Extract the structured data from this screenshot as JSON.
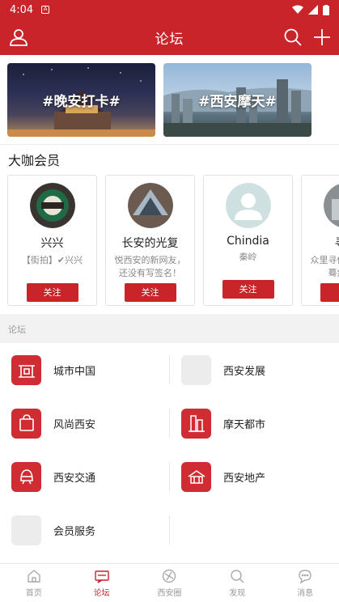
{
  "status_bar": {
    "time": "4:04"
  },
  "header": {
    "title": "论坛"
  },
  "banners": [
    {
      "label": "#晚安打卡#"
    },
    {
      "label": "#西安摩天#"
    }
  ],
  "members_section": {
    "title": "大咖会员",
    "members": [
      {
        "name": "兴兴",
        "desc": "【街拍】✔兴兴",
        "follow": "关注"
      },
      {
        "name": "长安的光复",
        "desc": "悦西安的新网友，还没有写签名！",
        "follow": "关注"
      },
      {
        "name": "Chindia",
        "desc": "秦岭",
        "follow": "关注"
      },
      {
        "name": "寻他",
        "desc": "众里寻他千百度，蓦然回首",
        "follow": "关"
      }
    ]
  },
  "forum": {
    "section_label": "论坛",
    "items": [
      {
        "label": "城市中国",
        "icon": "city-china-icon"
      },
      {
        "label": "西安发展",
        "icon": "placeholder-icon"
      },
      {
        "label": "风尚西安",
        "icon": "shopping-bag-icon"
      },
      {
        "label": "摩天都市",
        "icon": "skyscraper-icon"
      },
      {
        "label": "西安交通",
        "icon": "train-icon"
      },
      {
        "label": "西安地产",
        "icon": "building-icon"
      },
      {
        "label": "会员服务",
        "icon": "placeholder-icon"
      }
    ]
  },
  "tabbar": {
    "tabs": [
      {
        "label": "首页",
        "icon": "home-icon"
      },
      {
        "label": "论坛",
        "icon": "forum-icon"
      },
      {
        "label": "西安圈",
        "icon": "circle-icon"
      },
      {
        "label": "发现",
        "icon": "discover-icon"
      },
      {
        "label": "消息",
        "icon": "message-icon"
      }
    ],
    "active": "论坛"
  },
  "colors": {
    "brand": "#c8242a"
  }
}
